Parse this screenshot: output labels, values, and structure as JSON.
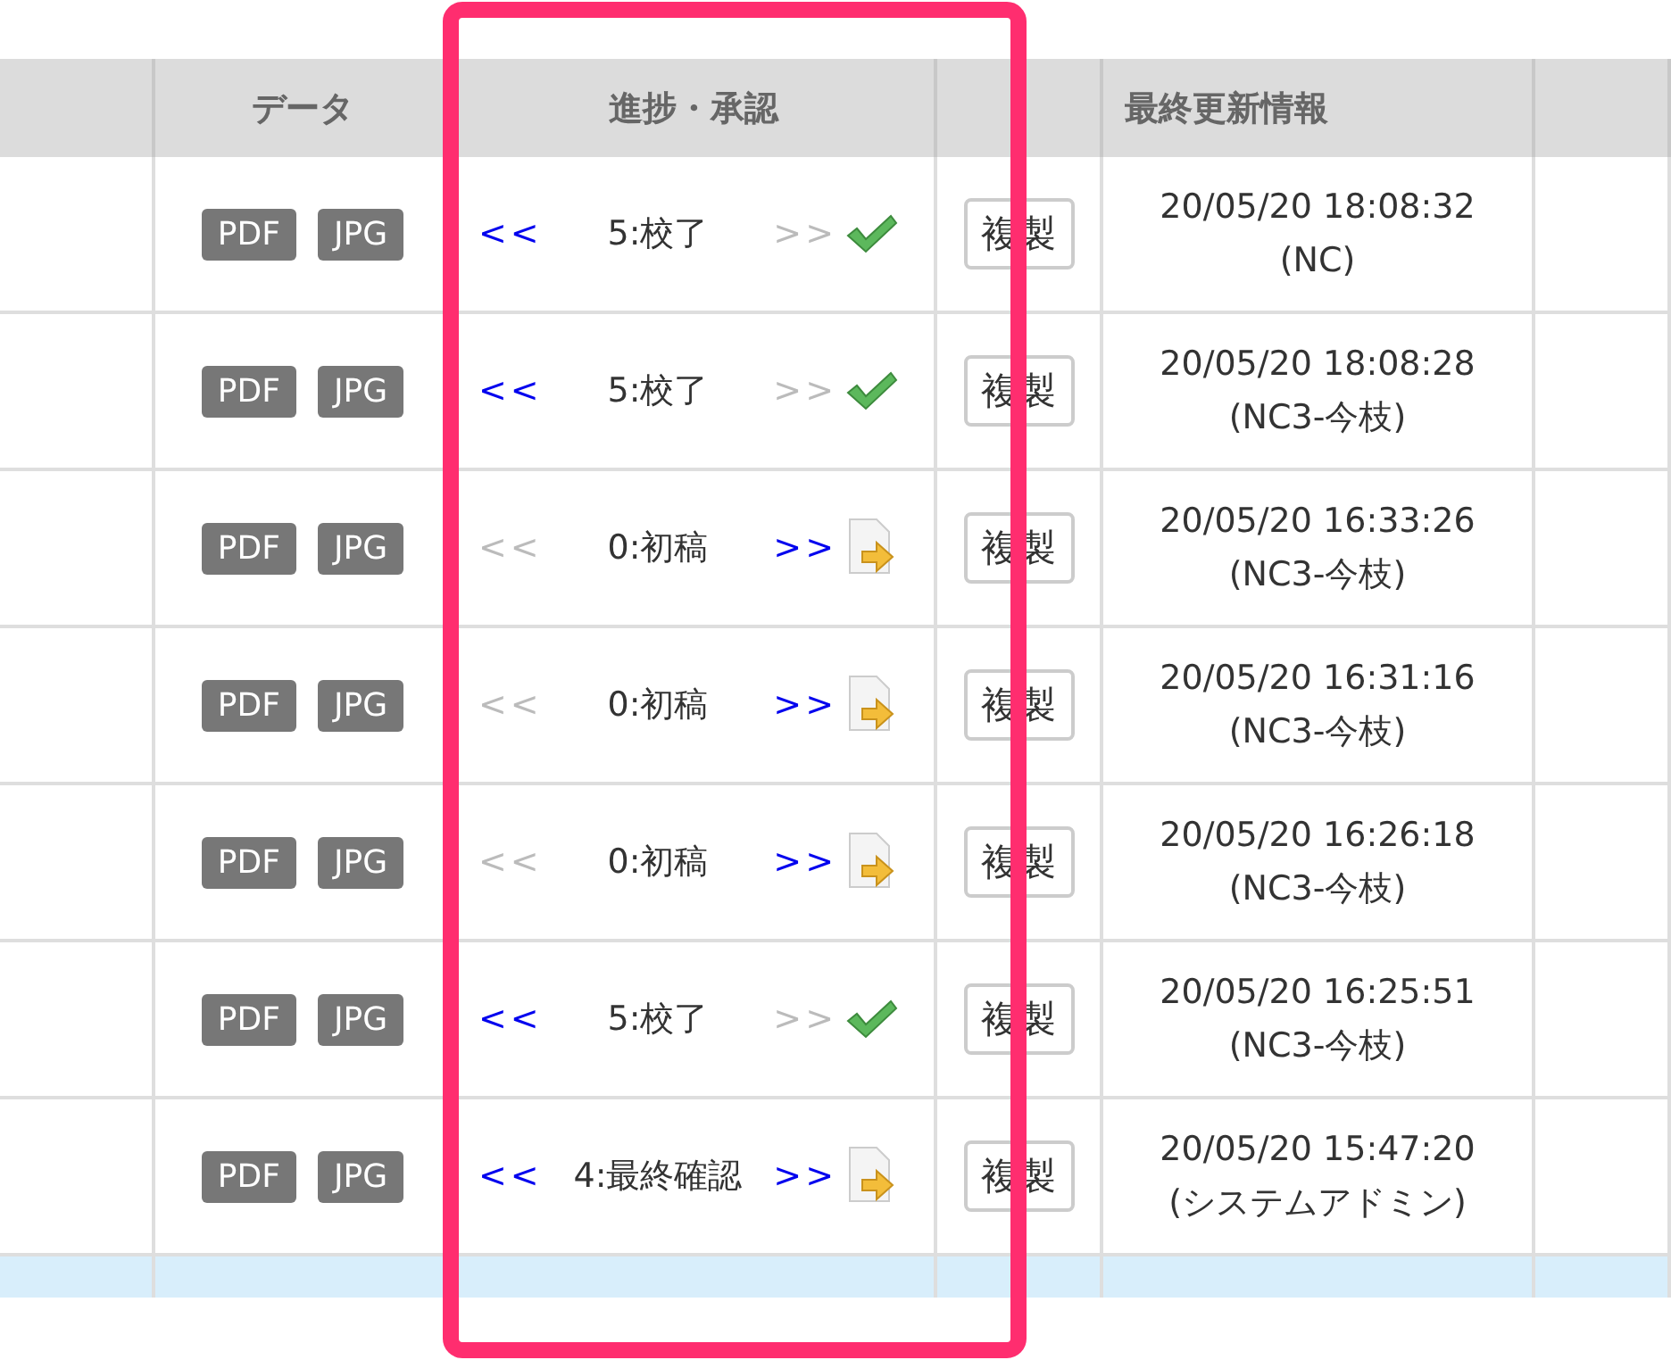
{
  "table": {
    "columns": [
      "データ",
      "進捗・承認",
      "最終更新情報"
    ],
    "rows": [
      {
        "buttons": [
          "PDF",
          "JPG"
        ],
        "prev": {
          "label": "<<",
          "enabled": true
        },
        "status": "5:校了",
        "next": {
          "label": ">>",
          "enabled": false
        },
        "status_icon": {
          "kind": "check"
        },
        "copy": "複製",
        "updated": "20/05/20 18:08:32",
        "user": "(NC)"
      },
      {
        "buttons": [
          "PDF",
          "JPG"
        ],
        "prev": {
          "label": "<<",
          "enabled": true
        },
        "status": "5:校了",
        "next": {
          "label": ">>",
          "enabled": false
        },
        "status_icon": {
          "kind": "check"
        },
        "copy": "複製",
        "updated": "20/05/20 18:08:28",
        "user": "(NC3-今枝)"
      },
      {
        "buttons": [
          "PDF",
          "JPG"
        ],
        "prev": {
          "label": "<<",
          "enabled": false
        },
        "status": "0:初稿",
        "next": {
          "label": ">>",
          "enabled": true
        },
        "status_icon": {
          "kind": "forward"
        },
        "copy": "複製",
        "updated": "20/05/20 16:33:26",
        "user": "(NC3-今枝)"
      },
      {
        "buttons": [
          "PDF",
          "JPG"
        ],
        "prev": {
          "label": "<<",
          "enabled": false
        },
        "status": "0:初稿",
        "next": {
          "label": ">>",
          "enabled": true
        },
        "status_icon": {
          "kind": "forward"
        },
        "copy": "複製",
        "updated": "20/05/20 16:31:16",
        "user": "(NC3-今枝)"
      },
      {
        "buttons": [
          "PDF",
          "JPG"
        ],
        "prev": {
          "label": "<<",
          "enabled": false
        },
        "status": "0:初稿",
        "next": {
          "label": ">>",
          "enabled": true
        },
        "status_icon": {
          "kind": "forward"
        },
        "copy": "複製",
        "updated": "20/05/20 16:26:18",
        "user": "(NC3-今枝)"
      },
      {
        "buttons": [
          "PDF",
          "JPG"
        ],
        "prev": {
          "label": "<<",
          "enabled": true
        },
        "status": "5:校了",
        "next": {
          "label": ">>",
          "enabled": false
        },
        "status_icon": {
          "kind": "check"
        },
        "copy": "複製",
        "updated": "20/05/20 16:25:51",
        "user": "(NC3-今枝)"
      },
      {
        "buttons": [
          "PDF",
          "JPG"
        ],
        "prev": {
          "label": "<<",
          "enabled": true
        },
        "status": "4:最終確認",
        "next": {
          "label": ">>",
          "enabled": true
        },
        "status_icon": {
          "kind": "forward"
        },
        "copy": "複製",
        "updated": "20/05/20 15:47:20",
        "user": "(システムアドミン)"
      }
    ]
  }
}
